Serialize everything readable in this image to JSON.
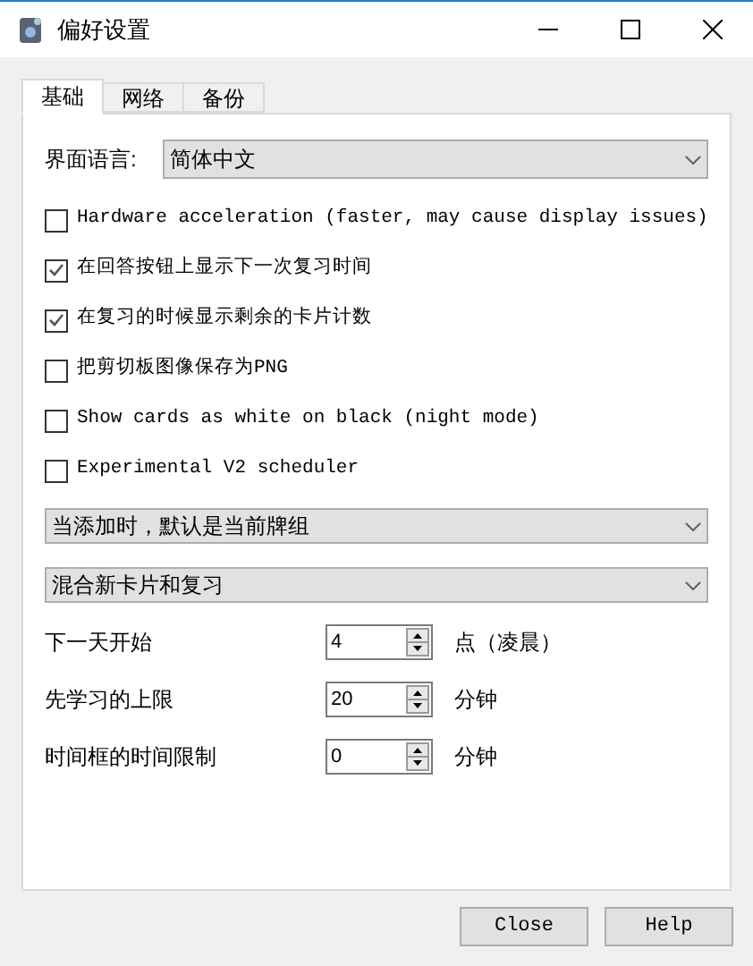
{
  "window": {
    "title": "偏好设置"
  },
  "tabs": [
    {
      "label": "基础",
      "selected": true
    },
    {
      "label": "网络",
      "selected": false
    },
    {
      "label": "备份",
      "selected": false
    }
  ],
  "language": {
    "label": "界面语言:",
    "value": "简体中文"
  },
  "options": [
    {
      "label": "Hardware acceleration (faster, may cause display issues)",
      "checked": false
    },
    {
      "label": "在回答按钮上显示下一次复习时间",
      "checked": true
    },
    {
      "label": "在复习的时候显示剩余的卡片计数",
      "checked": true
    },
    {
      "label": "把剪切板图像保存为PNG",
      "checked": false
    },
    {
      "label": "Show cards as white on black (night mode)",
      "checked": false
    },
    {
      "label": "Experimental V2 scheduler",
      "checked": false
    }
  ],
  "dropdowns": [
    {
      "value": "当添加时，默认是当前牌组"
    },
    {
      "value": "混合新卡片和复习"
    }
  ],
  "spinners": [
    {
      "label": "下一天开始",
      "value": "4",
      "unit": "点（凌晨）"
    },
    {
      "label": "先学习的上限",
      "value": "20",
      "unit": "分钟"
    },
    {
      "label": "时间框的时间限制",
      "value": "0",
      "unit": "分钟"
    }
  ],
  "buttons": [
    "Close",
    "Help"
  ]
}
